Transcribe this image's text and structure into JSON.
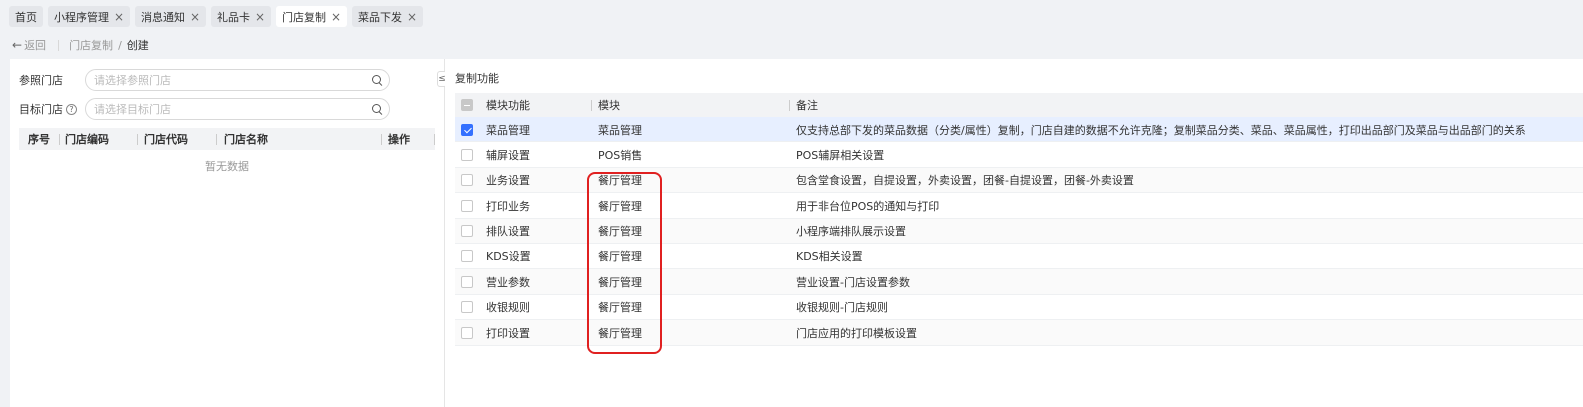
{
  "tabs": [
    {
      "label": "首页",
      "closable": false,
      "active": false
    },
    {
      "label": "小程序管理",
      "closable": true,
      "active": false
    },
    {
      "label": "消息通知",
      "closable": true,
      "active": false
    },
    {
      "label": "礼品卡",
      "closable": true,
      "active": false
    },
    {
      "label": "门店复制",
      "closable": true,
      "active": true
    },
    {
      "label": "菜品下发",
      "closable": true,
      "active": false
    }
  ],
  "close_glyph": "×",
  "breadcrumb": {
    "back": "返回",
    "parent": "门店复制",
    "slash": "/",
    "current": "创建"
  },
  "form": {
    "ref_store": {
      "label": "参照门店",
      "placeholder": "请选择参照门店"
    },
    "target_store": {
      "label": "目标门店",
      "help": "?",
      "placeholder": "请选择目标门店"
    }
  },
  "store_table": {
    "columns": [
      "序号",
      "门店编码",
      "门店代码",
      "门店名称",
      "操作"
    ],
    "empty_text": "暂无数据"
  },
  "collapse_glyph": "≤",
  "copy_panel": {
    "title": "复制功能",
    "columns": [
      "模块功能",
      "模块",
      "备注"
    ],
    "rows": [
      {
        "feature": "菜品管理",
        "module": "菜品管理",
        "note": "仅支持总部下发的菜品数据（分类/属性）复制，门店自建的数据不允许克隆；复制菜品分类、菜品、菜品属性，打印出品部门及菜品与出品部门的关系",
        "checked": true
      },
      {
        "feature": "辅屏设置",
        "module": "POS销售",
        "note": "POS辅屏相关设置",
        "checked": false
      },
      {
        "feature": "业务设置",
        "module": "餐厅管理",
        "note": "包含堂食设置，自提设置，外卖设置，团餐-自提设置，团餐-外卖设置",
        "checked": false
      },
      {
        "feature": "打印业务",
        "module": "餐厅管理",
        "note": "用于非台位POS的通知与打印",
        "checked": false
      },
      {
        "feature": "排队设置",
        "module": "餐厅管理",
        "note": "小程序端排队展示设置",
        "checked": false
      },
      {
        "feature": "KDS设置",
        "module": "餐厅管理",
        "note": "KDS相关设置",
        "checked": false
      },
      {
        "feature": "营业参数",
        "module": "餐厅管理",
        "note": "营业设置-门店设置参数",
        "checked": false
      },
      {
        "feature": "收银规则",
        "module": "餐厅管理",
        "note": "收银规则-门店规则",
        "checked": false
      },
      {
        "feature": "打印设置",
        "module": "餐厅管理",
        "note": "门店应用的打印模板设置",
        "checked": false
      }
    ]
  },
  "colors": {
    "accent": "#3370ff",
    "highlight": "#e02020",
    "selected_row": "#e7efff"
  }
}
